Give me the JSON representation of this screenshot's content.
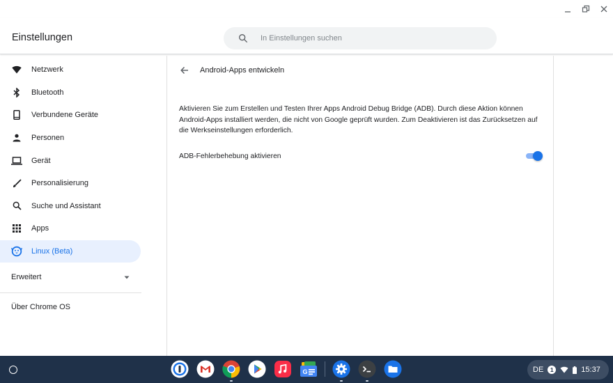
{
  "window": {
    "controls": {
      "minimize": "_",
      "restore": "⧉",
      "close": "✕"
    }
  },
  "header": {
    "title": "Einstellungen",
    "search_placeholder": "In Einstellungen suchen"
  },
  "sidebar": {
    "items": [
      {
        "label": "Netzwerk",
        "icon": "wifi-icon"
      },
      {
        "label": "Bluetooth",
        "icon": "bluetooth-icon"
      },
      {
        "label": "Verbundene Geräte",
        "icon": "phone-icon"
      },
      {
        "label": "Personen",
        "icon": "person-icon"
      },
      {
        "label": "Gerät",
        "icon": "laptop-icon"
      },
      {
        "label": "Personalisierung",
        "icon": "brush-icon"
      },
      {
        "label": "Suche und Assistant",
        "icon": "search-icon"
      },
      {
        "label": "Apps",
        "icon": "apps-grid-icon"
      },
      {
        "label": "Linux (Beta)",
        "icon": "linux-penguin-icon",
        "active": true
      }
    ],
    "advanced_label": "Erweitert",
    "about_label": "Über Chrome OS"
  },
  "content": {
    "subpage_title": "Android-Apps entwickeln",
    "description": "Aktivieren Sie zum Erstellen und Testen Ihrer Apps Android Debug Bridge (ADB). Durch diese Aktion können Android-Apps installiert werden, die nicht von Google geprüft wurden. Zum Deaktivieren ist das Zurücksetzen auf die Werkseinstellungen erforderlich.",
    "adb_toggle_label": "ADB-Fehlerbehebung aktivieren",
    "adb_toggle_on": true
  },
  "colors": {
    "accent": "#1a73e8",
    "active_bg": "#e8f0fe",
    "shelf": "#1f3149"
  },
  "shelf": {
    "apps": [
      {
        "name": "1password-icon"
      },
      {
        "name": "gmail-icon"
      },
      {
        "name": "chrome-icon"
      },
      {
        "name": "play-store-icon"
      },
      {
        "name": "music-icon"
      },
      {
        "name": "google-news-icon"
      },
      {
        "name": "settings-icon"
      },
      {
        "name": "terminal-icon"
      },
      {
        "name": "files-icon"
      }
    ],
    "tray": {
      "input_method": "DE",
      "notification_count": "1",
      "time": "15:37"
    }
  }
}
